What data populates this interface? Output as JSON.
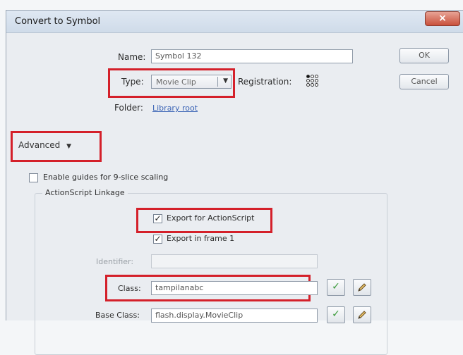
{
  "dialog": {
    "title": "Convert to Symbol",
    "close_label": "×"
  },
  "name": {
    "label": "Name:",
    "value": "Symbol 132"
  },
  "type": {
    "label": "Type:",
    "value": "Movie Clip",
    "arrow": "▼"
  },
  "registration": {
    "label": "Registration:",
    "selected_point": "top-left"
  },
  "folder": {
    "label": "Folder:",
    "value": "Library root"
  },
  "buttons": {
    "ok": "OK",
    "cancel": "Cancel"
  },
  "advanced": {
    "label": "Advanced",
    "arrow": "▼"
  },
  "nine_slice": {
    "label": "Enable guides for 9-slice scaling",
    "checked": false
  },
  "linkage": {
    "group_title": "ActionScript Linkage",
    "export_actionscript": {
      "label": "Export for ActionScript",
      "checked": true
    },
    "export_frame1": {
      "label": "Export in frame 1",
      "checked": true
    },
    "identifier": {
      "label": "Identifier:",
      "value": ""
    },
    "class": {
      "label": "Class:",
      "value": "tampilanabc"
    },
    "base_class": {
      "label": "Base Class:",
      "value": "flash.display.MovieClip"
    }
  },
  "icons": {
    "validate": "check-icon",
    "edit": "pencil-icon",
    "close": "close-icon",
    "registration": "registration-grid-icon"
  },
  "colors": {
    "highlight": "#d4202a",
    "link": "#3a63b5"
  },
  "check_mark": "✓"
}
